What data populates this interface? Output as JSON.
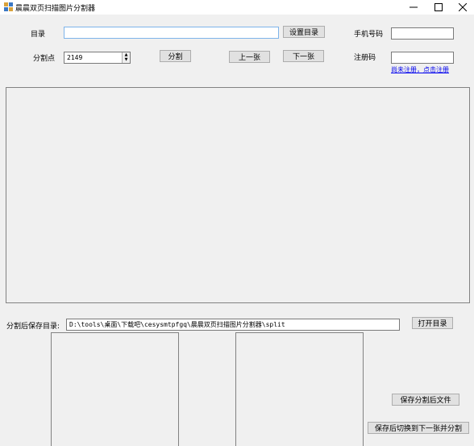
{
  "window": {
    "title": "晨晨双页扫描图片分割器",
    "icon": "app-icon",
    "controls": {
      "minimize": "─",
      "maximize": "☐",
      "close": "✕"
    }
  },
  "top": {
    "dir_label": "目录",
    "dir_value": "",
    "set_dir_button": "设置目录",
    "split_point_label": "分割点",
    "split_point_value": "2149",
    "split_button": "分割",
    "prev_button": "上一张",
    "next_button": "下一张"
  },
  "register": {
    "phone_label": "手机号码",
    "phone_value": "",
    "code_label": "注册码",
    "code_value": "",
    "link_text": "尚未注册，点击注册"
  },
  "bottom": {
    "save_dir_label": "分割后保存目录:",
    "save_dir_value": "D:\\tools\\桌面\\下载吧\\cesysmtpfgq\\晨晨双页扫描图片分割器\\split",
    "open_dir_button": "打开目录",
    "save_split_button": "保存分割后文件",
    "save_and_next_button": "保存后切换到下一张并分割"
  }
}
